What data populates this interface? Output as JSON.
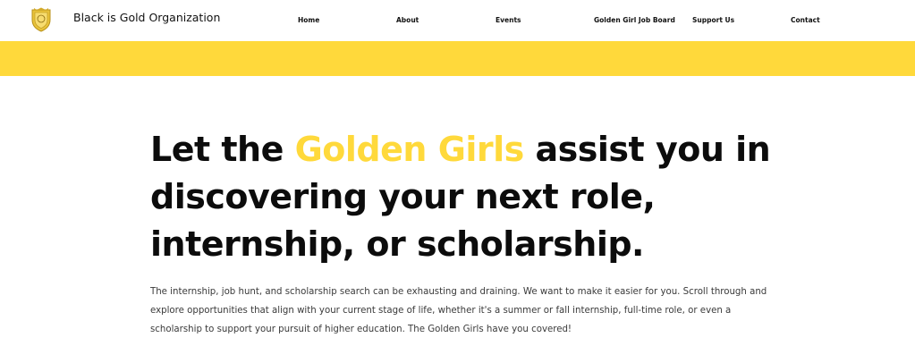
{
  "header": {
    "brand_name": "Black is Gold Organization",
    "logo_icon": "gold-crest-logo-icon"
  },
  "nav": {
    "items": [
      {
        "label": "Home"
      },
      {
        "label": "About"
      },
      {
        "label": "Events"
      },
      {
        "label": "Golden Girl Job Board"
      },
      {
        "label": "Support Us"
      },
      {
        "label": "Contact"
      }
    ]
  },
  "hero": {
    "headline_before": "Let the ",
    "headline_accent": "Golden Girls",
    "headline_after": " assist you in discovering your next role, internship, or scholarship.",
    "intro": "The internship, job hunt, and scholarship search can be exhausting and draining. We want to make it easier for you. Scroll through and explore opportunities that align with your current stage of life, whether it's a summer or fall internship, full-time role, or even a scholarship to support your pursuit of higher education. The Golden Girls have you covered!"
  },
  "colors": {
    "accent_gold": "#ffd93b",
    "text_dark": "#0c0c0c",
    "body_text": "#3a3a3a"
  }
}
